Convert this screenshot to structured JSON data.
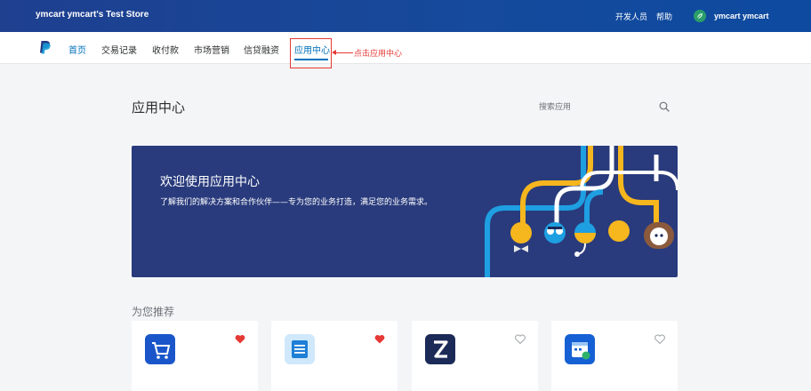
{
  "topbar": {
    "store_name": "ymcart ymcart's Test Store",
    "developer_label": "开发人员",
    "help_label": "帮助",
    "user_name": "ymcart ymcart"
  },
  "nav": {
    "items": [
      {
        "label": "首页"
      },
      {
        "label": "交易记录"
      },
      {
        "label": "收付款"
      },
      {
        "label": "市场营销"
      },
      {
        "label": "信贷融资"
      },
      {
        "label": "应用中心"
      }
    ],
    "annotation": "点击应用中心"
  },
  "page": {
    "title": "应用中心",
    "search_placeholder": "搜索应用"
  },
  "banner": {
    "title": "欢迎使用应用中心",
    "text": "了解我们的解决方案和合作伙伴——专为您的业务打造，满足您的业务需求。"
  },
  "recommended": {
    "title": "为您推荐",
    "cards": [
      {
        "icon": "shopping-cart-icon",
        "icon_color": "#1a56c9",
        "favorited": true
      },
      {
        "icon": "receipt-icon",
        "icon_color": "#cfe8fb",
        "favorited": true
      },
      {
        "icon": "z-logo-icon",
        "icon_color": "#1c2a57",
        "favorited": false
      },
      {
        "icon": "calendar-icon",
        "icon_color": "#1560d4",
        "favorited": false
      }
    ]
  },
  "colors": {
    "brand_blue": "#0070ba",
    "topbar": "#1f3f8f",
    "banner_bg": "#293b7c",
    "annotation_red": "#e53935",
    "heart_red": "#e53935"
  }
}
